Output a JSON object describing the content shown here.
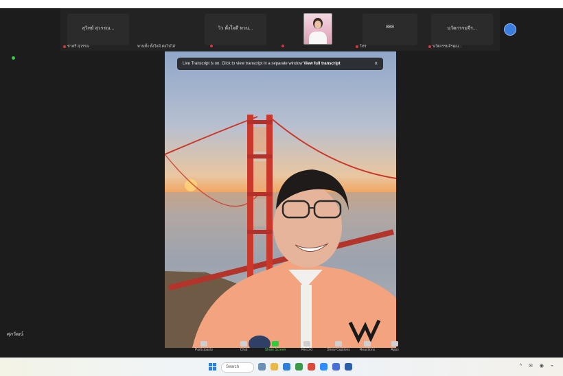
{
  "strip": {
    "tiles": [
      {
        "name": "สุวิทย์ สุวรรณ...",
        "label": "ชาตรี สุวรรณ"
      },
      {
        "name": "วิว ตั้งใจดี ทวน...",
        "label": "ทวนทั้ง ตั้งใจดี ต่อไม่ได้"
      },
      {
        "name": "",
        "label": ""
      },
      {
        "name": "888",
        "label": "โทร"
      },
      {
        "name": "นวัตกรรมจีร...",
        "label": "นวัตกรรมจีรคุณ..."
      }
    ]
  },
  "banner": {
    "text": "Live Transcript is on. Click to view transcript in a separate window",
    "link": "View full transcript",
    "close": "×"
  },
  "speaker": {
    "name": "ศุภวัฒน์"
  },
  "toolbar": {
    "items": [
      {
        "label": "Participants",
        "icon": "people-icon"
      },
      {
        "label": "Chat",
        "icon": "chat-icon"
      },
      {
        "label": "Share Screen",
        "icon": "share-screen-icon",
        "accent": true
      },
      {
        "label": "Record",
        "icon": "record-icon"
      },
      {
        "label": "Show Captions",
        "icon": "captions-icon"
      },
      {
        "label": "Reactions",
        "icon": "reactions-icon"
      },
      {
        "label": "Apps",
        "icon": "apps-icon"
      }
    ]
  },
  "taskbar": {
    "search": "Search",
    "tray": "^ ✉ ◉ ⌁"
  },
  "colors": {
    "accent": "#2ecc40",
    "window": "#1c1c1c",
    "mic_off": "#d23a3a"
  }
}
